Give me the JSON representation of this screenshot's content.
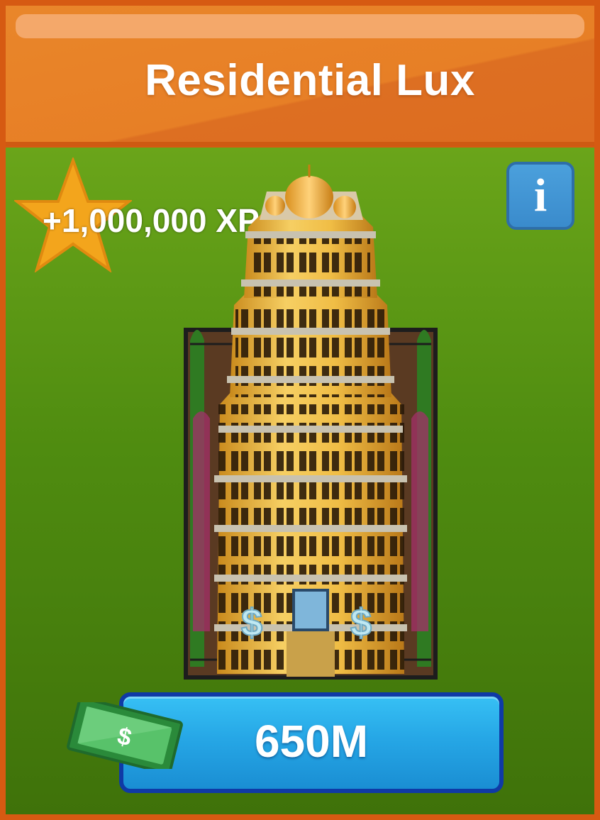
{
  "building": {
    "name": "Residential Lux",
    "xp_reward": "+1,000,000 XP",
    "price": "650M"
  },
  "icons": {
    "info": "i",
    "info_icon_name": "info-icon",
    "reward_icon_name": "star-icon",
    "currency_icon_name": "cash-bill-icon",
    "currency_symbol": "$"
  },
  "colors": {
    "header": "#e77f26",
    "panel": "#4f8c10",
    "buy_button": "#26a7e6",
    "star": "#f3a51c"
  }
}
